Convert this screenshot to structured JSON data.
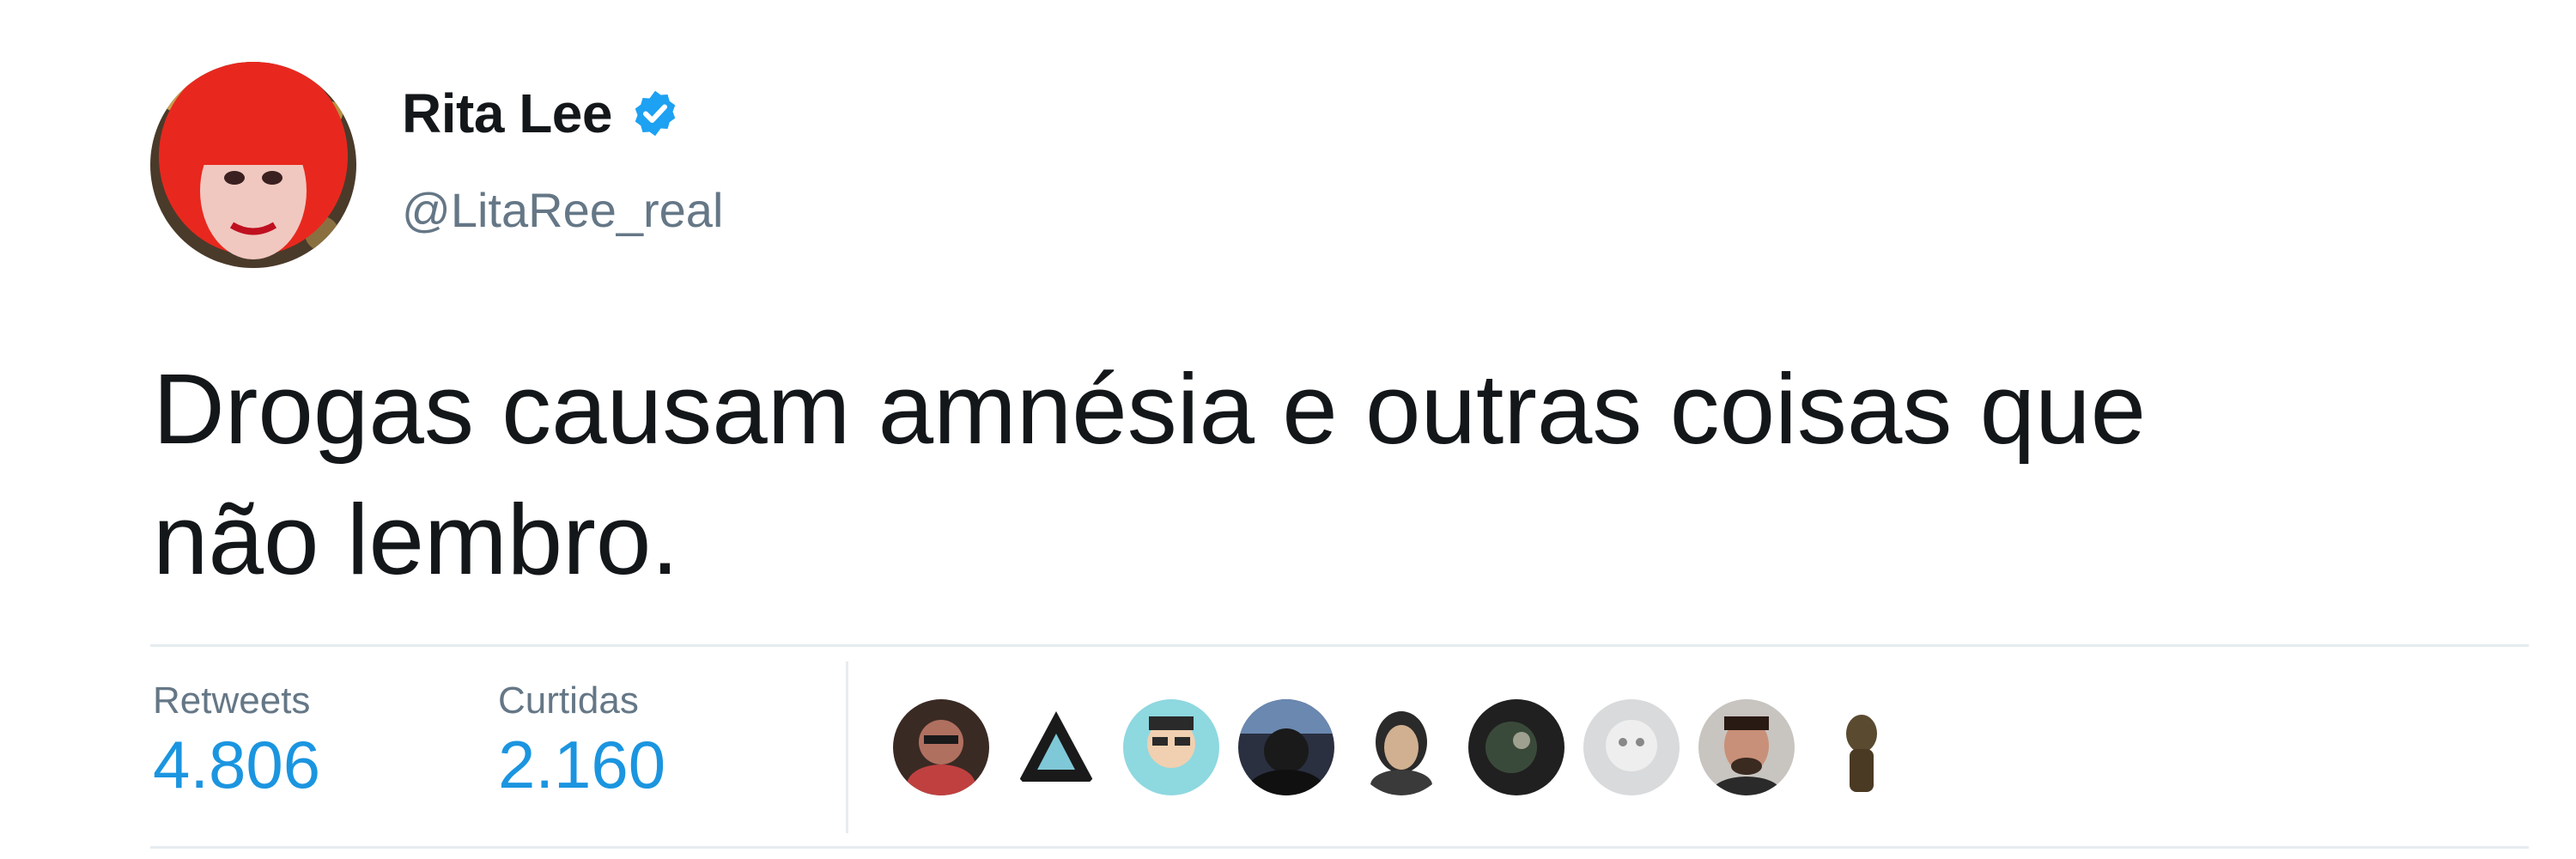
{
  "author": {
    "display_name": "Rita Lee",
    "handle": "@LitaRee_real",
    "verified": true,
    "avatar_icon": "profile-photo-red-hair"
  },
  "tweet": {
    "text_line1": "Drogas causam amnésia e outras coisas que",
    "text_line2": "não lembro."
  },
  "stats": {
    "retweets_label": "Retweets",
    "retweets_value": "4.806",
    "likes_label": "Curtidas",
    "likes_value": "2.160"
  },
  "liked_by_avatars": [
    "liker-avatar-1",
    "liker-avatar-2",
    "liker-avatar-3",
    "liker-avatar-4",
    "liker-avatar-5",
    "liker-avatar-6",
    "liker-avatar-7",
    "liker-avatar-8",
    "liker-avatar-9"
  ],
  "colors": {
    "text": "#14171a",
    "secondary": "#657786",
    "accent": "#1b95e0",
    "verified_badge": "#1da1f2",
    "divider": "#e6ecf0"
  }
}
